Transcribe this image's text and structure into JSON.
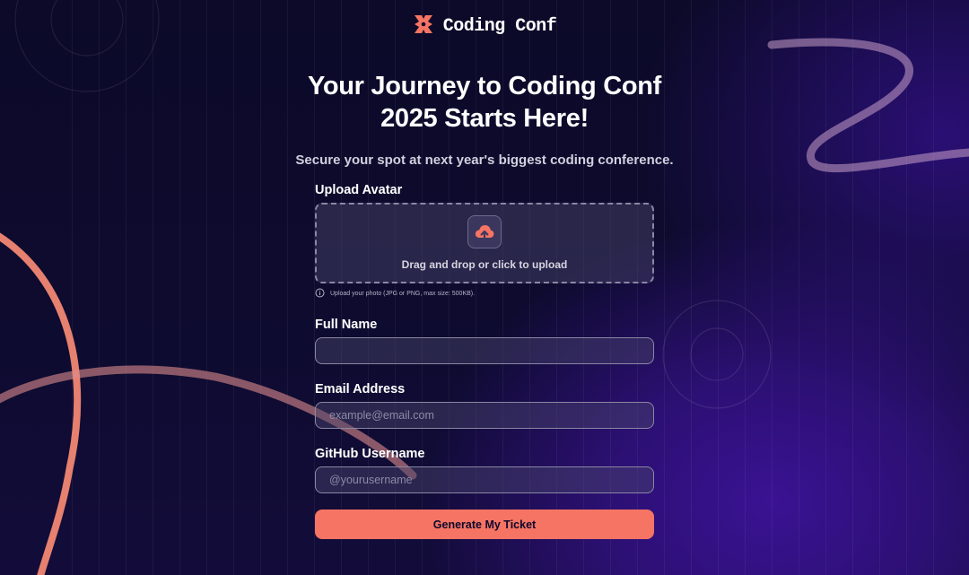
{
  "brand": {
    "name": "Coding Conf",
    "logo_icon": "coding-conf-logo-icon"
  },
  "hero": {
    "title_line1": "Your Journey to Coding Conf",
    "title_line2": "2025 Starts Here!",
    "subtitle": "Secure your spot at next year's biggest coding conference."
  },
  "form": {
    "avatar": {
      "label": "Upload Avatar",
      "icon": "cloud-upload-icon",
      "drop_text": "Drag and drop or click to upload",
      "hint_icon": "info-icon",
      "hint": "Upload your photo (JPG or PNG, max size: 500KB)."
    },
    "full_name": {
      "label": "Full Name",
      "value": "",
      "placeholder": ""
    },
    "email": {
      "label": "Email Address",
      "value": "",
      "placeholder": "example@email.com"
    },
    "github": {
      "label": "GitHub Username",
      "value": "",
      "placeholder": "@yourusername"
    },
    "submit_label": "Generate My Ticket"
  },
  "colors": {
    "accent": "#f57463",
    "background": "#0d0a2a",
    "glow": "#3a1293"
  }
}
